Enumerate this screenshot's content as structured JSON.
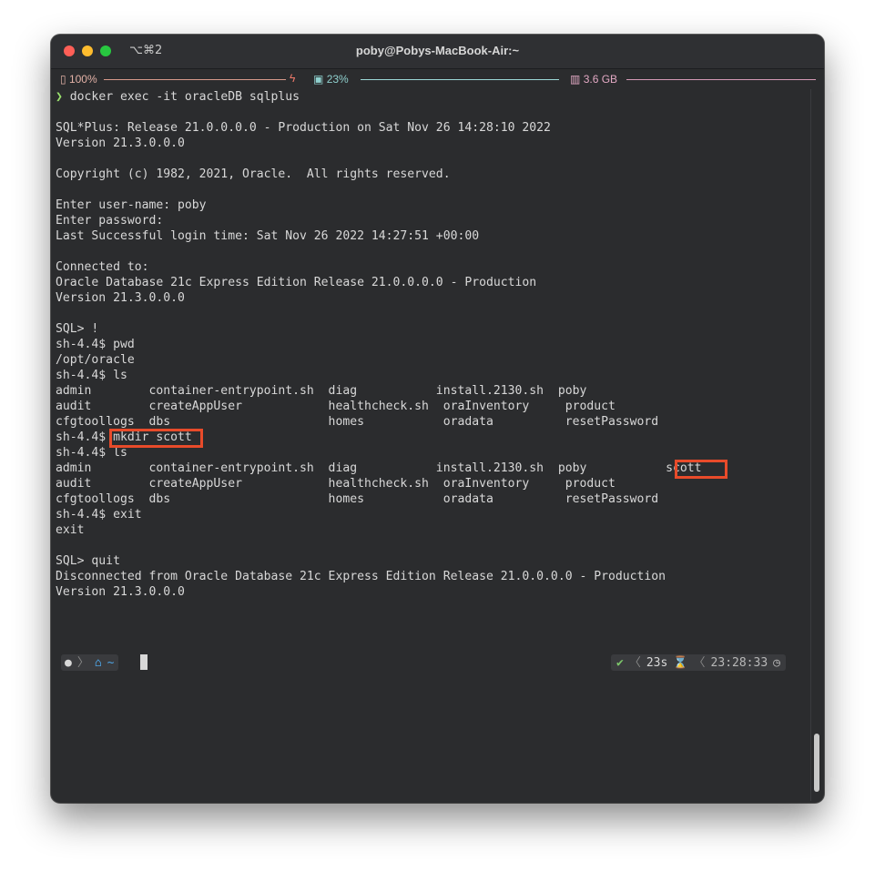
{
  "window": {
    "tab_shortcut": "⌥⌘2",
    "title": "poby@Pobys-MacBook-Air:~"
  },
  "statusbar": {
    "battery": "100%",
    "cpu": "23%",
    "memory": "3.6 GB"
  },
  "terminal": {
    "lines": [
      "docker exec -it oracleDB sqlplus",
      "",
      "SQL*Plus: Release 21.0.0.0.0 - Production on Sat Nov 26 14:28:10 2022",
      "Version 21.3.0.0.0",
      "",
      "Copyright (c) 1982, 2021, Oracle.  All rights reserved.",
      "",
      "Enter user-name: poby",
      "Enter password:",
      "Last Successful login time: Sat Nov 26 2022 14:27:51 +00:00",
      "",
      "Connected to:",
      "Oracle Database 21c Express Edition Release 21.0.0.0.0 - Production",
      "Version 21.3.0.0.0",
      "",
      "SQL> !",
      "sh-4.4$ pwd",
      "/opt/oracle",
      "sh-4.4$ ls",
      "admin        container-entrypoint.sh  diag           install.2130.sh  poby",
      "audit        createAppUser            healthcheck.sh  oraInventory     product",
      "cfgtoollogs  dbs                      homes           oradata          resetPassword",
      "sh-4.4$ mkdir scott",
      "sh-4.4$ ls",
      "admin        container-entrypoint.sh  diag           install.2130.sh  poby           scott",
      "audit        createAppUser            healthcheck.sh  oraInventory     product",
      "cfgtoollogs  dbs                      homes           oradata          resetPassword",
      "sh-4.4$ exit",
      "exit",
      "",
      "SQL> quit",
      "Disconnected from Oracle Database 21c Express Edition Release 21.0.0.0.0 - Production",
      "Version 21.3.0.0.0"
    ],
    "prompt_arrow": "❯"
  },
  "prompt": {
    "apple_icon": "apple-icon",
    "home_icon": "home-icon",
    "path": "~",
    "status_check": "✔",
    "duration": "23s",
    "hourglass": "⌛",
    "time": "23:28:33",
    "clock_icon": "clock-icon"
  },
  "colors": {
    "background": "#2b2c2e",
    "foreground": "#d8d8d8",
    "highlight_box": "#e84b2a",
    "prompt_green": "#9be26e"
  }
}
